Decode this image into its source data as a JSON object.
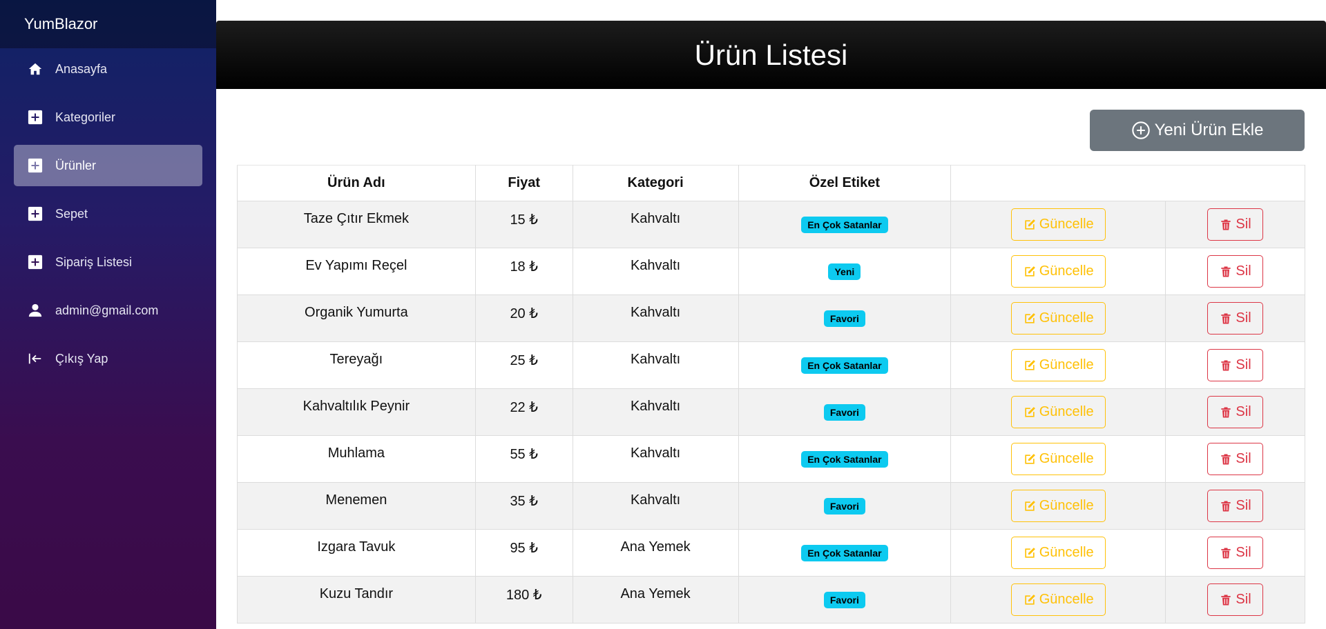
{
  "app": {
    "brand": "YumBlazor"
  },
  "sidebar": {
    "items": [
      {
        "label": "Anasayfa",
        "icon": "home-icon",
        "active": false
      },
      {
        "label": "Kategoriler",
        "icon": "plus-square-icon",
        "active": false
      },
      {
        "label": "Ürünler",
        "icon": "plus-square-icon",
        "active": true
      },
      {
        "label": "Sepet",
        "icon": "plus-square-icon",
        "active": false
      },
      {
        "label": "Sipariş Listesi",
        "icon": "plus-square-icon",
        "active": false
      },
      {
        "label": "admin@gmail.com",
        "icon": "user-icon",
        "active": false
      },
      {
        "label": "Çıkış Yap",
        "icon": "logout-icon",
        "active": false
      }
    ]
  },
  "header": {
    "title": "Ürün Listesi"
  },
  "toolbar": {
    "add_label": "Yeni Ürün Ekle"
  },
  "table": {
    "headers": [
      "Ürün Adı",
      "Fiyat",
      "Kategori",
      "Özel Etiket",
      ""
    ],
    "update_label": "Güncelle",
    "delete_label": "Sil",
    "rows": [
      {
        "name": "Taze Çıtır Ekmek",
        "price": "15 ₺",
        "category": "Kahvaltı",
        "tag": "En Çok Satanlar"
      },
      {
        "name": "Ev Yapımı Reçel",
        "price": "18 ₺",
        "category": "Kahvaltı",
        "tag": "Yeni"
      },
      {
        "name": "Organik Yumurta",
        "price": "20 ₺",
        "category": "Kahvaltı",
        "tag": "Favori"
      },
      {
        "name": "Tereyağı",
        "price": "25 ₺",
        "category": "Kahvaltı",
        "tag": "En Çok Satanlar"
      },
      {
        "name": "Kahvaltılık Peynir",
        "price": "22 ₺",
        "category": "Kahvaltı",
        "tag": "Favori"
      },
      {
        "name": "Muhlama",
        "price": "55 ₺",
        "category": "Kahvaltı",
        "tag": "En Çok Satanlar"
      },
      {
        "name": "Menemen",
        "price": "35 ₺",
        "category": "Kahvaltı",
        "tag": "Favori"
      },
      {
        "name": "Izgara Tavuk",
        "price": "95 ₺",
        "category": "Ana Yemek",
        "tag": "En Çok Satanlar"
      },
      {
        "name": "Kuzu Tandır",
        "price": "180 ₺",
        "category": "Ana Yemek",
        "tag": "Favori"
      }
    ]
  },
  "colors": {
    "accent_warning": "#ffc107",
    "accent_danger": "#dc3545",
    "badge_info": "#0dcaf0",
    "secondary": "#6c757d"
  }
}
